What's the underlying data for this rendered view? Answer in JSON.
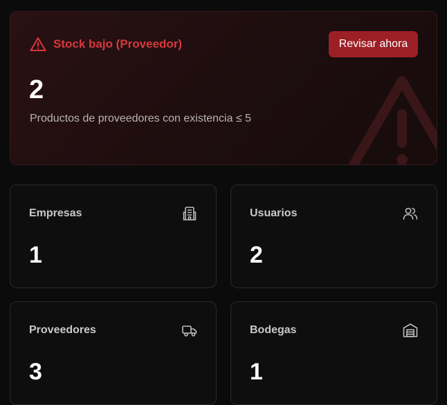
{
  "alert": {
    "title": "Stock bajo (Proveedor)",
    "button_label": "Revisar ahora",
    "count": "2",
    "description": "Productos de proveedores con existencia ≤ 5",
    "icon": "alert-triangle-icon",
    "accent_color": "#d8383d",
    "button_color": "#9c1f25"
  },
  "stats": [
    {
      "label": "Empresas",
      "value": "1",
      "icon": "building-icon"
    },
    {
      "label": "Usuarios",
      "value": "2",
      "icon": "users-icon"
    },
    {
      "label": "Proveedores",
      "value": "3",
      "icon": "truck-icon"
    },
    {
      "label": "Bodegas",
      "value": "1",
      "icon": "warehouse-icon"
    }
  ]
}
